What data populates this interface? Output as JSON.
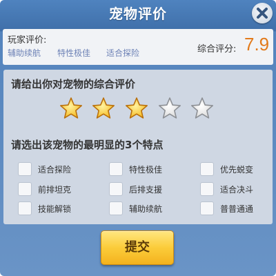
{
  "dialog": {
    "title": "宠物评价",
    "close_icon": "close-icon"
  },
  "summary": {
    "player_label": "玩家评价:",
    "tags": [
      "辅助续航",
      "特性极佳",
      "适合探险"
    ],
    "score_label": "综合评分:",
    "score_value": "7.9"
  },
  "rating": {
    "prompt": "请给出你对宠物的综合评价",
    "stars_total": 5,
    "stars_filled": 3
  },
  "features": {
    "prompt": "请选出该宠物的最明显的3个特点",
    "options": [
      {
        "label": "适合探险",
        "checked": false
      },
      {
        "label": "特性极佳",
        "checked": false
      },
      {
        "label": "优先蜕变",
        "checked": false
      },
      {
        "label": "前排坦克",
        "checked": false
      },
      {
        "label": "后排支援",
        "checked": false
      },
      {
        "label": "适合决斗",
        "checked": false
      },
      {
        "label": "技能解锁",
        "checked": false
      },
      {
        "label": "辅助续航",
        "checked": false
      },
      {
        "label": "普普通通",
        "checked": false
      }
    ]
  },
  "submit_label": "提交",
  "colors": {
    "header_blue": "#4f83bf",
    "score_orange": "#e27a1a",
    "tag_blue": "#6d82b6",
    "star_gold": "#f5b81c",
    "star_silver": "#d9d9d9",
    "button_yellow": "#fbcc3a"
  }
}
